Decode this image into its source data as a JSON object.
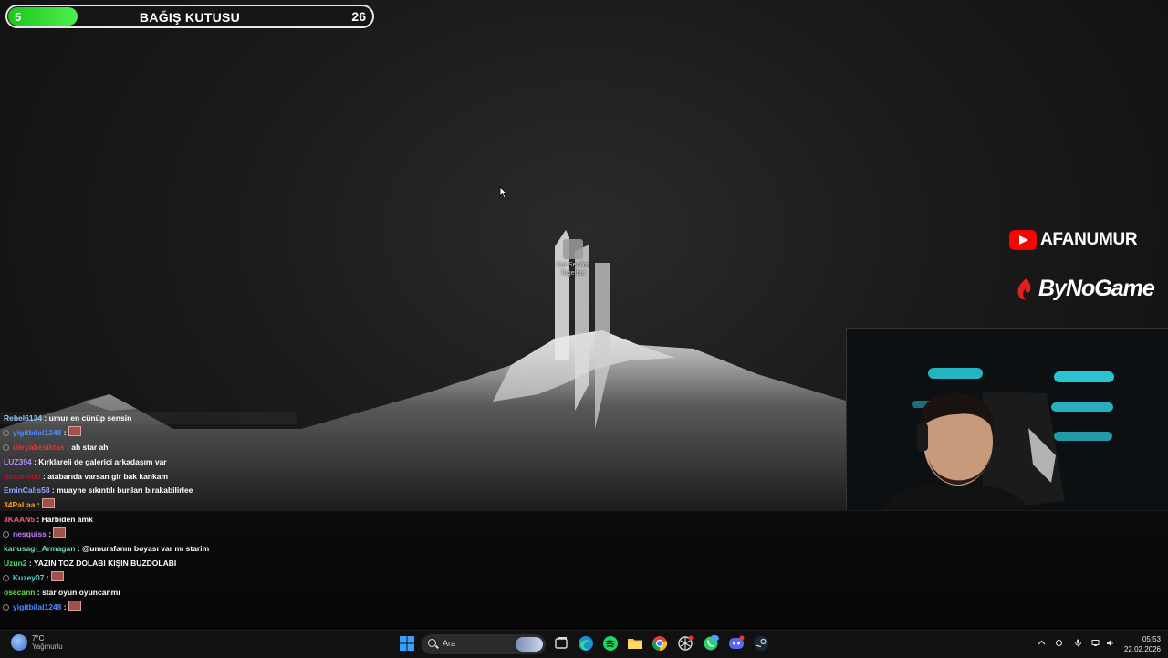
{
  "donation_box": {
    "title": "BAĞIŞ KUTUSU",
    "current": "5",
    "goal": "26",
    "progress_fraction": 0.19
  },
  "desktop": {
    "icon_label": "Car Service Together"
  },
  "brand": {
    "youtube_channel": "AFANUMUR",
    "sponsor": "ByNoGame"
  },
  "chat": {
    "messages": [
      {
        "user": "Rebel6134",
        "text": "umur en cünüp sensin",
        "color": "#8fc8ff",
        "badge": false,
        "emote": false
      },
      {
        "user": "yigitbilal1248",
        "text": "",
        "color": "#4a8cff",
        "badge": true,
        "emote": true
      },
      {
        "user": "deryabesiktas",
        "text": "ah star ah",
        "color": "#d93a3a",
        "badge": true,
        "emote": false
      },
      {
        "user": "LUZ394",
        "text": "Kırklareli de galerici arkadaşım var",
        "color": "#b18cff",
        "badge": false,
        "emote": false
      },
      {
        "user": "mrcano0o",
        "text": "atabarıda varsan gir bak kankam",
        "color": "#c0102a",
        "badge": false,
        "emote": false
      },
      {
        "user": "EminCalis58",
        "text": "muayne sıkıntılı bunları bırakabilirlee",
        "color": "#8fa8ff",
        "badge": false,
        "emote": false
      },
      {
        "user": "34PaLaa",
        "text": "",
        "color": "#ff9a1f",
        "badge": false,
        "emote": true
      },
      {
        "user": "3KAAN5",
        "text": "Harbiden amk",
        "color": "#ff5a7a",
        "badge": false,
        "emote": false
      },
      {
        "user": "nesquiss",
        "text": "",
        "color": "#c57aff",
        "badge": true,
        "emote": true
      },
      {
        "user": "kanusagi_Armagan",
        "text": "@umurafanın boyası var mı starim",
        "color": "#6fd6b0",
        "badge": false,
        "emote": false
      },
      {
        "user": "Uzun2",
        "text": "YAZIN TOZ DOLABI KIŞIN BUZDOLABI",
        "color": "#44e06a",
        "badge": false,
        "emote": false
      },
      {
        "user": "Kuzey07",
        "text": "",
        "color": "#53d6c6",
        "badge": true,
        "emote": true
      },
      {
        "user": "osecann",
        "text": "star oyun oyuncanmı",
        "color": "#66dd44",
        "badge": false,
        "emote": false
      },
      {
        "user": "yigitbilal1248",
        "text": "",
        "color": "#4a8cff",
        "badge": true,
        "emote": true
      }
    ]
  },
  "taskbar": {
    "weather_temp": "7°C",
    "weather_condition": "Yağmurlu",
    "search_placeholder": "Ara",
    "time": "05:53",
    "date": "22.02.2026",
    "apps": [
      "windows-start",
      "task-view",
      "edge",
      "spotify",
      "file-explorer",
      "chrome",
      "chatgpt",
      "whatsapp",
      "discord",
      "steam"
    ]
  }
}
